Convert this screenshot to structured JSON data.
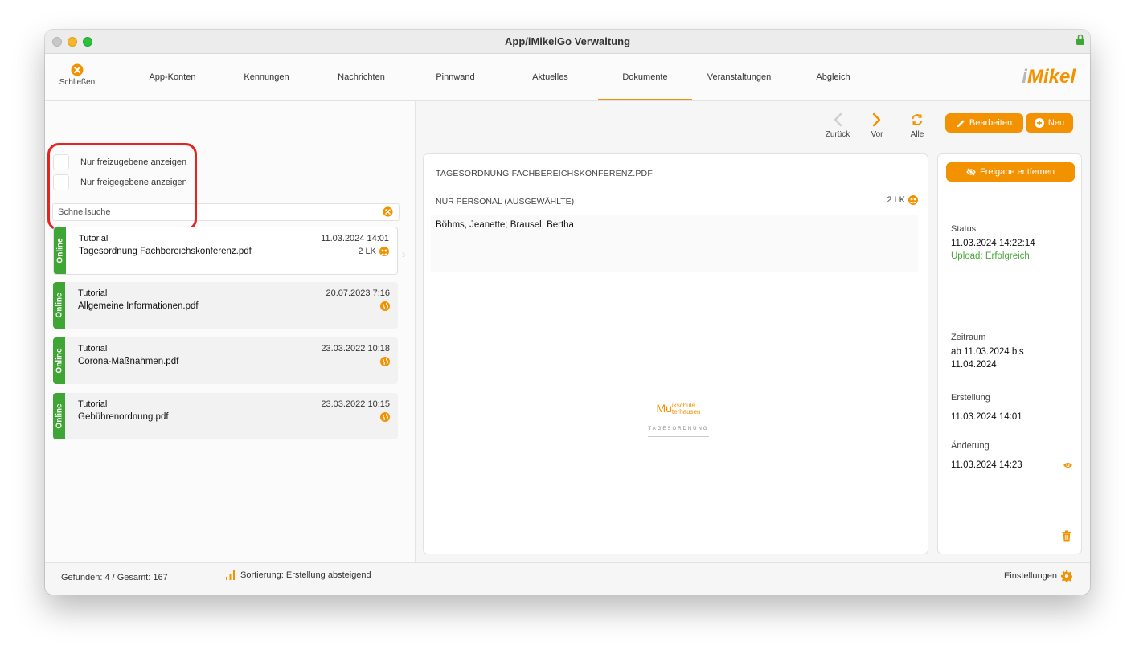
{
  "window": {
    "title": "App/iMikelGo Verwaltung"
  },
  "toolbar": {
    "close_label": "Schließen",
    "tabs": [
      {
        "label": "App-Konten"
      },
      {
        "label": "Kennungen"
      },
      {
        "label": "Nachrichten"
      },
      {
        "label": "Pinnwand"
      },
      {
        "label": "Aktuelles"
      },
      {
        "label": "Dokumente",
        "active": true
      },
      {
        "label": "Veranstaltungen"
      },
      {
        "label": "Abgleich"
      }
    ],
    "logo_i": "i",
    "logo_mikel": "Mikel"
  },
  "filters": {
    "only_unreleased": "Nur freizugebene anzeigen",
    "only_released": "Nur freigegebene anzeigen",
    "search_placeholder": "Schnellsuche"
  },
  "documents": [
    {
      "status": "Online",
      "category": "Tutorial",
      "name": "Tagesordnung Fachbereichskonferenz.pdf",
      "date": "11.03.2024 14:01",
      "meta": "2 LK",
      "icon": "group-icon",
      "selected": true
    },
    {
      "status": "Online",
      "category": "Tutorial",
      "name": "Allgemeine Informationen.pdf",
      "date": "20.07.2023 7:16",
      "meta": "",
      "icon": "globe-icon"
    },
    {
      "status": "Online",
      "category": "Tutorial",
      "name": "Corona-Maßnahmen.pdf",
      "date": "23.03.2022 10:18",
      "meta": "",
      "icon": "globe-icon"
    },
    {
      "status": "Online",
      "category": "Tutorial",
      "name": "Gebührenordnung.pdf",
      "date": "23.03.2022 10:15",
      "meta": "",
      "icon": "globe-icon"
    }
  ],
  "nav": {
    "back": "Zurück",
    "forward": "Vor",
    "all": "Alle"
  },
  "actions": {
    "edit": "Bearbeiten",
    "new": "Neu",
    "unrelease": "Freigabe entfernen"
  },
  "preview": {
    "title": "TAGESORDNUNG FACHBEREICHSKONFERENZ.PDF",
    "audience": "NUR PERSONAL (AUSGEWÄHLTE)",
    "audience_count": "2 LK",
    "recipients": "Böhms, Jeanette; Brausel, Bertha",
    "thumb_org_prefix": "Mu",
    "thumb_org_line1": "ikschule",
    "thumb_org_line2": "terhausen",
    "thumb_heading": "TAGESORDNUNG"
  },
  "details": {
    "status_label": "Status",
    "status_time": "11.03.2024 14:22:14",
    "status_upload": "Upload: Erfolgreich",
    "period_label": "Zeitraum",
    "period_line1": "ab 11.03.2024 bis",
    "period_line2": "11.04.2024",
    "created_label": "Erstellung",
    "created_value": "11.03.2024 14:01",
    "changed_label": "Änderung",
    "changed_value": "11.03.2024 14:23"
  },
  "footer": {
    "found": "Gefunden: 4 / Gesamt: 167",
    "sort": "Sortierung: Erstellung absteigend",
    "settings": "Einstellungen"
  },
  "colors": {
    "accent": "#f39200",
    "online": "#3fa535",
    "success": "#48a73a",
    "highlight": "#e8231f"
  }
}
